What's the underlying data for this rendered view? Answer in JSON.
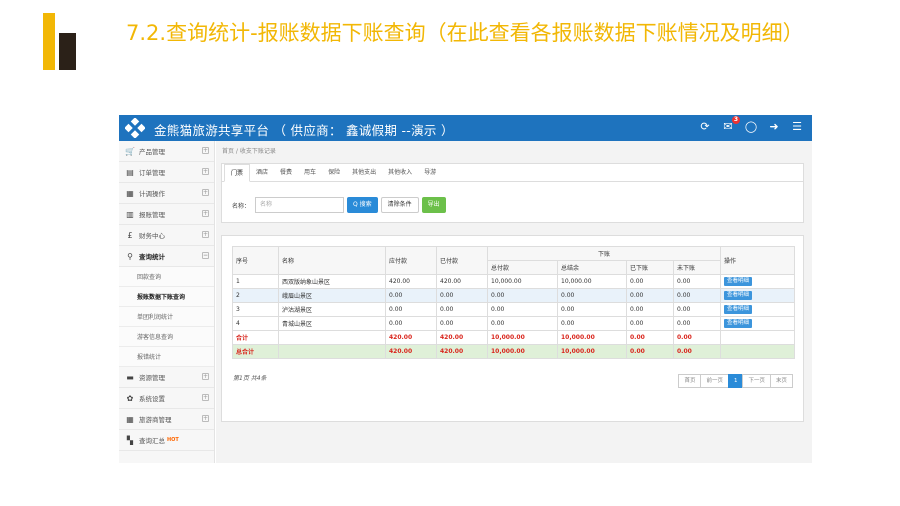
{
  "slide": {
    "title": "7.2.查询统计-报账数据下账查询（在此查看各报账数据下账情况及明细）"
  },
  "header": {
    "app_title": "金熊猫旅游共享平台 （ 供应商： 鑫诚假期 --演示 ）",
    "icons": [
      "refresh-icon",
      "mail-icon",
      "chat-icon",
      "logout-icon",
      "menu-icon"
    ],
    "mail_badge": "3"
  },
  "sidebar": {
    "items": [
      {
        "icon": "cart-icon",
        "glyph": "🛒",
        "label": "产品管理"
      },
      {
        "icon": "order-icon",
        "glyph": "▤",
        "label": "订单管理"
      },
      {
        "icon": "plan-icon",
        "glyph": "▦",
        "label": "计调操作"
      },
      {
        "icon": "report-icon",
        "glyph": "▥",
        "label": "报账管理"
      },
      {
        "icon": "finance-icon",
        "glyph": "£",
        "label": "财务中心"
      },
      {
        "icon": "search-icon",
        "glyph": "⚲",
        "label": "查询统计"
      }
    ],
    "subitems": [
      {
        "label": "回款查询"
      },
      {
        "label": "报账数据下账查询"
      },
      {
        "label": "单团利润统计"
      },
      {
        "label": "游客信息查询"
      },
      {
        "label": "报错统计"
      }
    ],
    "items_after": [
      {
        "icon": "resource-icon",
        "glyph": "▬",
        "label": "资源管理"
      },
      {
        "icon": "settings-icon",
        "glyph": "✿",
        "label": "系统设置"
      },
      {
        "icon": "agency-icon",
        "glyph": "▦",
        "label": "旅游商管理"
      },
      {
        "icon": "summary-icon",
        "glyph": "▚",
        "label": "查询汇总",
        "badge": "HOT"
      }
    ]
  },
  "breadcrumb": "首页 / 收支下账记录",
  "tabs": [
    "门票",
    "酒店",
    "餐费",
    "用车",
    "保险",
    "其他支出",
    "其他收入",
    "导游"
  ],
  "search": {
    "label": "名称：",
    "placeholder": "名称",
    "search_button": "Q 搜索",
    "clear_button": "清除条件",
    "export_button": "导出"
  },
  "table": {
    "headers": {
      "index": "序号",
      "name": "名称",
      "payable": "应付款",
      "paid": "已付款",
      "group": "下账",
      "total_paid": "总付款",
      "total_settle": "总结余",
      "settled": "已下账",
      "unsettled": "未下账",
      "action": "操作"
    },
    "rows": [
      {
        "index": "1",
        "name": "西双版纳象山景区",
        "payable": "420.00",
        "paid": "420.00",
        "total_paid": "10,000.00",
        "total_settle": "10,000.00",
        "settled": "0.00",
        "unsettled": "0.00",
        "action": "查看明细"
      },
      {
        "index": "2",
        "name": "峨眉山景区",
        "payable": "0.00",
        "paid": "0.00",
        "total_paid": "0.00",
        "total_settle": "0.00",
        "settled": "0.00",
        "unsettled": "0.00",
        "action": "查看明细"
      },
      {
        "index": "3",
        "name": "泸沽湖景区",
        "payable": "0.00",
        "paid": "0.00",
        "total_paid": "0.00",
        "total_settle": "0.00",
        "settled": "0.00",
        "unsettled": "0.00",
        "action": "查看明细"
      },
      {
        "index": "4",
        "name": "青城山景区",
        "payable": "0.00",
        "paid": "0.00",
        "total_paid": "0.00",
        "total_settle": "0.00",
        "settled": "0.00",
        "unsettled": "0.00",
        "action": "查看明细"
      }
    ],
    "subtotal": {
      "label": "合计",
      "payable": "420.00",
      "paid": "420.00",
      "total_paid": "10,000.00",
      "total_settle": "10,000.00",
      "settled": "0.00",
      "unsettled": "0.00"
    },
    "total": {
      "label": "总合计",
      "payable": "420.00",
      "paid": "420.00",
      "total_paid": "10,000.00",
      "total_settle": "10,000.00",
      "settled": "0.00",
      "unsettled": "0.00"
    }
  },
  "pagination": {
    "info": "第1页 共4条",
    "buttons": [
      "首页",
      "前一页",
      "1",
      "下一页",
      "末页"
    ],
    "current": "1"
  },
  "colors": {
    "accent": "#1e73be",
    "title": "#f2b705",
    "total": "#d9251c"
  }
}
